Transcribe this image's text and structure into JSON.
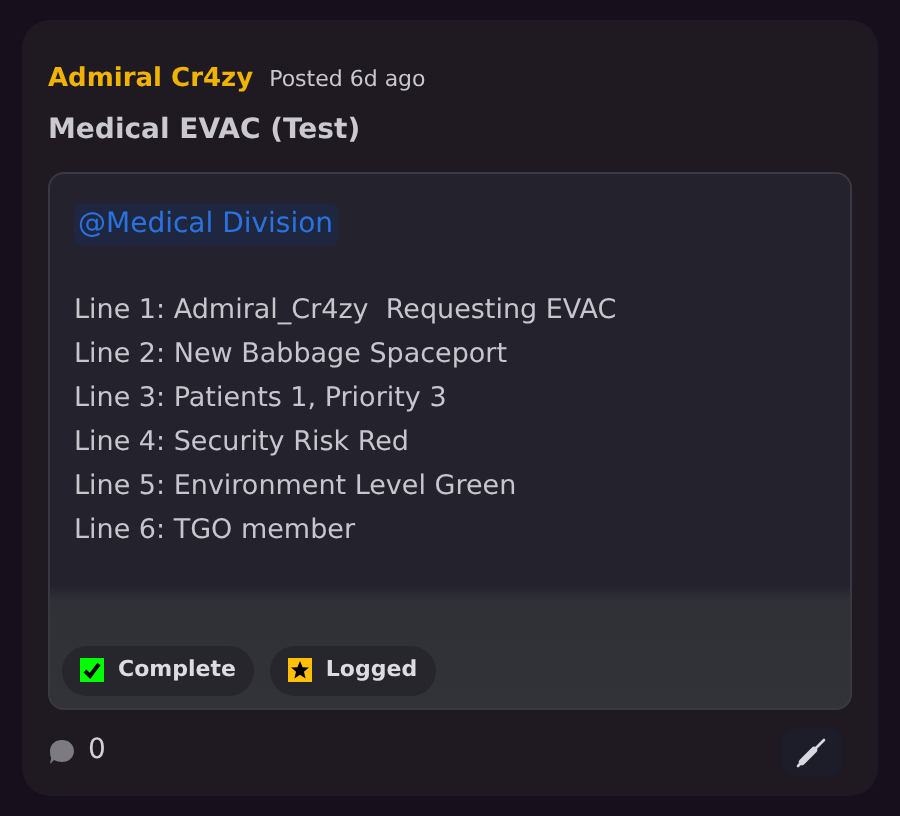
{
  "post": {
    "author": "Admiral Cr4zy",
    "posted": "Posted 6d ago",
    "title": "Medical EVAC (Test)",
    "mention": "@Medical Division",
    "lines": [
      "Line 1: Admiral_Cr4zy  Requesting EVAC",
      "Line 2: New Babbage Spaceport",
      "Line 3: Patients 1, Priority 3",
      "Line 4: Security Risk Red",
      "Line 5: Environment Level Green",
      "Line 6: TGO member"
    ],
    "tags": [
      {
        "kind": "check",
        "label": "Complete",
        "color": "#00ff00"
      },
      {
        "kind": "star",
        "label": "Logged",
        "color": "#ffc107"
      }
    ],
    "comment_count": "0"
  }
}
